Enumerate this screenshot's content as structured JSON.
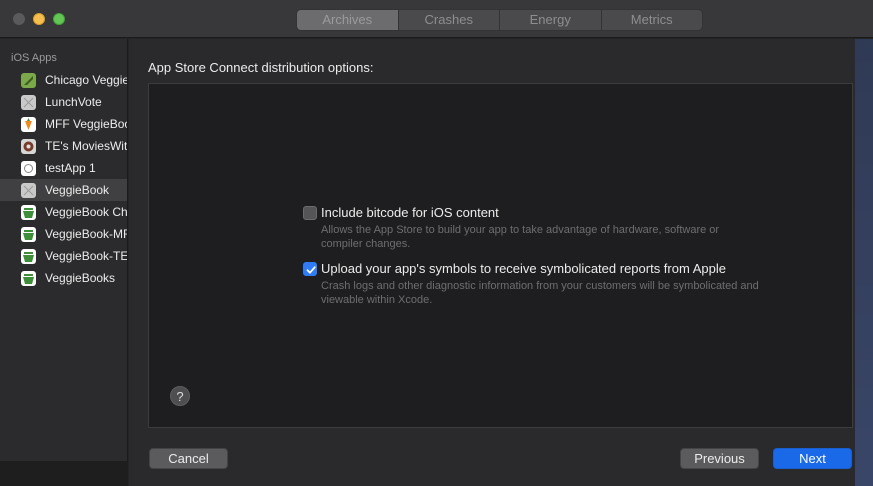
{
  "titlebar": {
    "tabs": [
      {
        "label": "Archives",
        "active": true
      },
      {
        "label": "Crashes",
        "active": false
      },
      {
        "label": "Energy",
        "active": false
      },
      {
        "label": "Metrics",
        "active": false
      }
    ]
  },
  "sidebar": {
    "header": "iOS Apps",
    "items": [
      {
        "label": "Chicago Veggie",
        "icon": "chicago-veggie-app-icon",
        "selected": false
      },
      {
        "label": "LunchVote",
        "icon": "lunchvote-app-icon",
        "selected": false
      },
      {
        "label": "MFF VeggieBoo",
        "icon": "mff-veggiebook-app-icon",
        "selected": false
      },
      {
        "label": "TE's MoviesWith",
        "icon": "te-movies-app-icon",
        "selected": false
      },
      {
        "label": "testApp 1",
        "icon": "testapp-app-icon",
        "selected": false
      },
      {
        "label": "VeggieBook",
        "icon": "veggiebook-app-icon",
        "selected": true
      },
      {
        "label": "VeggieBook Chi",
        "icon": "veggiebook-chi-app-icon",
        "selected": false
      },
      {
        "label": "VeggieBook-MF",
        "icon": "veggiebook-mf-app-icon",
        "selected": false
      },
      {
        "label": "VeggieBook-TE",
        "icon": "veggiebook-te-app-icon",
        "selected": false
      },
      {
        "label": "VeggieBooks",
        "icon": "veggiebooks-app-icon",
        "selected": false
      }
    ]
  },
  "sheet": {
    "title": "App Store Connect distribution options:",
    "options": [
      {
        "title": "Include bitcode for iOS content",
        "description": "Allows the App Store to build your app to take advantage of hardware, software or compiler changes.",
        "checked": false
      },
      {
        "title": "Upload your app's symbols to receive symbolicated reports from Apple",
        "description": "Crash logs and other diagnostic information from your customers will be symbolicated and viewable within Xcode.",
        "checked": true
      }
    ],
    "help_label": "?",
    "buttons": {
      "cancel": "Cancel",
      "previous": "Previous",
      "next": "Next"
    }
  },
  "colors": {
    "accent": "#1a69e8",
    "checkbox_checked": "#2f7cf6"
  }
}
